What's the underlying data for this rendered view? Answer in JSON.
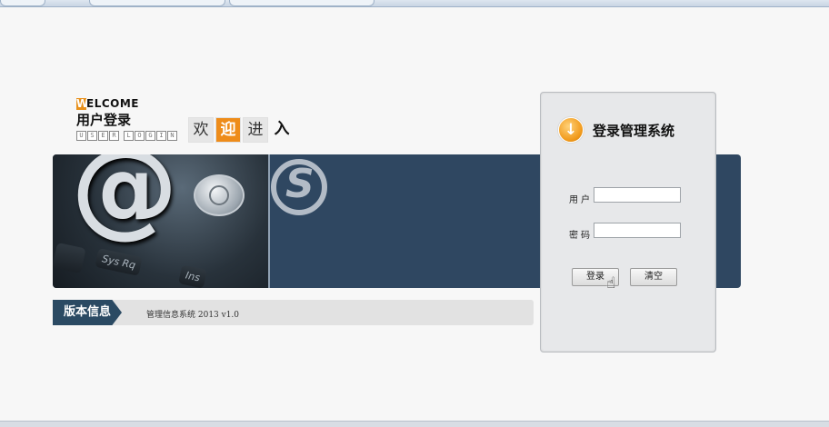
{
  "welcome": {
    "title_first": "W",
    "title_rest": "ELCOME",
    "title_cn": "用户登录",
    "title_en_letters": [
      "U",
      "S",
      "E",
      "R",
      "",
      "L",
      "O",
      "G",
      "I",
      "N"
    ]
  },
  "greeting": [
    "欢",
    "迎",
    "进",
    "入"
  ],
  "banner": {
    "keys": [
      "Sys Rq",
      "Ins"
    ]
  },
  "version": {
    "label": "版本信息",
    "text": "管理信息系统  2013 v1.0"
  },
  "login": {
    "title": "登录管理系统",
    "username_label": "用户",
    "username_value": "",
    "password_label": "密码",
    "password_value": "",
    "login_button": "登录",
    "clear_button": "清空"
  },
  "colors": {
    "accent": "#ee8c1a",
    "banner": "#2f4761",
    "version_label": "#2b4a63"
  }
}
